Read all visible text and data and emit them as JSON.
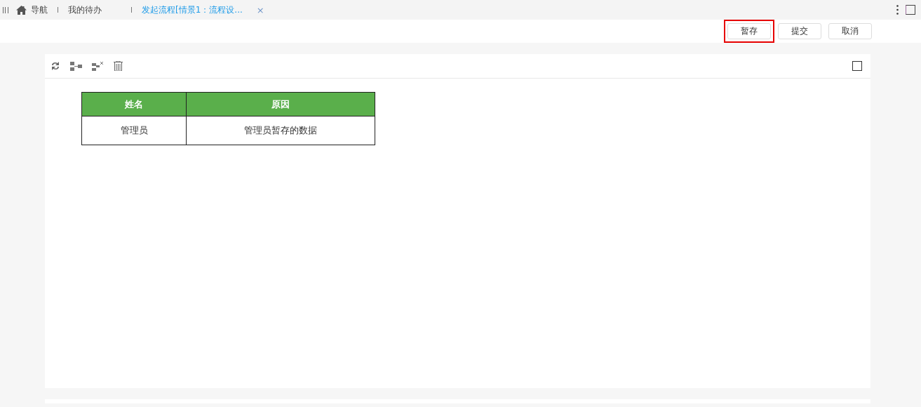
{
  "tabs": [
    {
      "label": "导航",
      "kind": "home",
      "selected": false
    },
    {
      "label": "我的待办",
      "kind": "plain",
      "selected": false
    },
    {
      "label": "发起流程[情景1：流程设...",
      "kind": "closable",
      "selected": true
    }
  ],
  "close_glyph": "×",
  "actions": [
    {
      "label": "暂存",
      "highlighted": true
    },
    {
      "label": "提交",
      "highlighted": false
    },
    {
      "label": "取消",
      "highlighted": false
    }
  ],
  "table": {
    "columns": [
      "姓名",
      "原因"
    ],
    "rows": [
      [
        "管理员",
        "管理员暂存的数据"
      ]
    ]
  }
}
